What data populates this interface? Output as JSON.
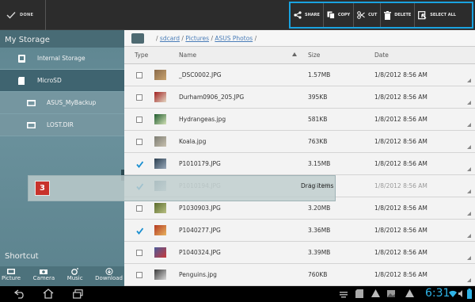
{
  "actionbar": {
    "done_label": "DONE",
    "actions": [
      {
        "name": "share-button",
        "icon": "share-icon",
        "label": "SHARE"
      },
      {
        "name": "copy-button",
        "icon": "copy-icon",
        "label": "COPY"
      },
      {
        "name": "cut-button",
        "icon": "scissors-icon",
        "label": "CUT"
      },
      {
        "name": "delete-button",
        "icon": "trash-icon",
        "label": "DELETE"
      },
      {
        "name": "select-all-button",
        "icon": "select-all-icon",
        "label": "SELECT ALL"
      }
    ],
    "highlight_color": "#1aa3e0"
  },
  "sidebar": {
    "title": "My Storage",
    "items": [
      {
        "label": "Internal Storage",
        "icon": "phone-storage-icon"
      },
      {
        "label": "MicroSD",
        "icon": "sdcard-icon"
      },
      {
        "label": "ASUS_MyBackup",
        "icon": "folder-icon"
      },
      {
        "label": "LOST.DIR",
        "icon": "folder-icon"
      }
    ],
    "shortcut_title": "Shortcut",
    "shortcuts": [
      {
        "label": "Picture",
        "icon": "picture-icon"
      },
      {
        "label": "Camera",
        "icon": "camera-icon"
      },
      {
        "label": "Music",
        "icon": "music-icon"
      },
      {
        "label": "Download",
        "icon": "download-icon"
      }
    ]
  },
  "path": {
    "sep": "/",
    "seg1": "sdcard",
    "seg2": "Pictures",
    "seg3": "ASUS Photos"
  },
  "columns": {
    "type": "Type",
    "name": "Name",
    "size": "Size",
    "date": "Date"
  },
  "files": [
    {
      "name": "_DSC0002.JPG",
      "size": "1.57MB",
      "date": "1/8/2012 8:56 AM",
      "checked": false
    },
    {
      "name": "Durham0906_205.JPG",
      "size": "395KB",
      "date": "1/8/2012 8:56 AM",
      "checked": false
    },
    {
      "name": "Hydrangeas.jpg",
      "size": "581KB",
      "date": "1/8/2012 8:56 AM",
      "checked": false
    },
    {
      "name": "Koala.jpg",
      "size": "763KB",
      "date": "1/8/2012 8:56 AM",
      "checked": false
    },
    {
      "name": "P1010179.JPG",
      "size": "3.15MB",
      "date": "1/8/2012 8:56 AM",
      "checked": true
    },
    {
      "name": "P1010194.JPG",
      "size": "3.41MB",
      "date": "1/8/2012 8:56 AM",
      "checked": true
    },
    {
      "name": "P1030903.JPG",
      "size": "3.20MB",
      "date": "1/8/2012 8:56 AM",
      "checked": false
    },
    {
      "name": "P1040277.JPG",
      "size": "3.36MB",
      "date": "1/8/2012 8:56 AM",
      "checked": true
    },
    {
      "name": "P1040324.JPG",
      "size": "3.39MB",
      "date": "1/8/2012 8:56 AM",
      "checked": false
    },
    {
      "name": "Penguins.jpg",
      "size": "760KB",
      "date": "1/8/2012 8:56 AM",
      "checked": false
    }
  ],
  "drag": {
    "count": "3",
    "label": "Drag items"
  },
  "system": {
    "clock": "6:31"
  }
}
